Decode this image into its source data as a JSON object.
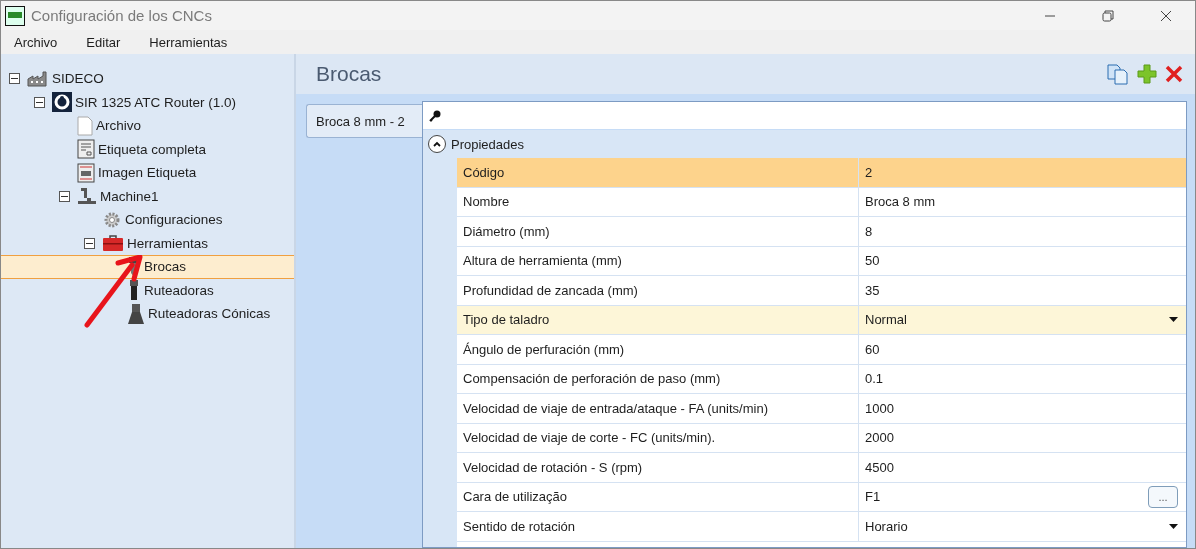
{
  "window": {
    "title": "Configuración de los CNCs"
  },
  "menu": [
    {
      "label": "Archivo"
    },
    {
      "label": "Editar"
    },
    {
      "label": "Herramientas"
    }
  ],
  "tree": [
    {
      "label": "SIDECO",
      "kind": "factory",
      "expanded": true,
      "selected": false,
      "children": [
        {
          "label": "SIR 1325 ATC Router (1.0)",
          "kind": "logo",
          "expanded": true,
          "selected": false,
          "children": [
            {
              "label": "Archivo",
              "kind": "document",
              "selected": false
            },
            {
              "label": "Etiqueta completa",
              "kind": "label",
              "selected": false
            },
            {
              "label": "Imagen Etiqueta",
              "kind": "image-label",
              "selected": false
            },
            {
              "label": "Machine1",
              "kind": "machine",
              "expanded": true,
              "selected": false,
              "children": [
                {
                  "label": "Configuraciones",
                  "kind": "gear",
                  "selected": false
                },
                {
                  "label": "Herramientas",
                  "kind": "toolbox",
                  "expanded": true,
                  "selected": false,
                  "children": [
                    {
                      "label": "Brocas",
                      "kind": "drill",
                      "selected": true
                    },
                    {
                      "label": "Ruteadoras",
                      "kind": "router",
                      "selected": false
                    },
                    {
                      "label": "Ruteadoras Cónicas",
                      "kind": "conical",
                      "selected": false
                    }
                  ]
                }
              ]
            }
          ]
        }
      ]
    }
  ],
  "panel": {
    "title": "Brocas",
    "tabs": [
      {
        "label": "Broca 8 mm - 2",
        "selected": true
      }
    ]
  },
  "property_grid": {
    "category": {
      "label": "Propiedades",
      "expanded": true
    },
    "rows": [
      {
        "name": "Código",
        "value": "2",
        "kind": "text",
        "selected": true,
        "hovered": false
      },
      {
        "name": "Nombre",
        "value": "Broca 8 mm",
        "kind": "text",
        "selected": false,
        "hovered": false
      },
      {
        "name": "Diámetro (mm)",
        "value": "8",
        "kind": "text",
        "selected": false,
        "hovered": false
      },
      {
        "name": "Altura de herramienta (mm)",
        "value": "50",
        "kind": "text",
        "selected": false,
        "hovered": false
      },
      {
        "name": "Profundidad de zancada (mm)",
        "value": "35",
        "kind": "text",
        "selected": false,
        "hovered": false
      },
      {
        "name": "Tipo de taladro",
        "value": "Normal",
        "kind": "dropdown",
        "selected": false,
        "hovered": true
      },
      {
        "name": "Ángulo de perfuración (mm)",
        "value": "60",
        "kind": "text",
        "selected": false,
        "hovered": false
      },
      {
        "name": "Compensación de perforación de paso (mm)",
        "value": "0.1",
        "kind": "text",
        "selected": false,
        "hovered": false
      },
      {
        "name": "Velocidad de viaje de entrada/ataque - FA (units/min)",
        "value": "1000",
        "kind": "text",
        "selected": false,
        "hovered": false
      },
      {
        "name": "Velocidad de viaje de corte - FC (units/min).",
        "value": "2000",
        "kind": "text",
        "selected": false,
        "hovered": false
      },
      {
        "name": "Velocidad de rotación - S (rpm)",
        "value": "4500",
        "kind": "text",
        "selected": false,
        "hovered": false
      },
      {
        "name": "Cara de utilização",
        "value": "F1",
        "kind": "ellipsis",
        "button": "...",
        "selected": false,
        "hovered": false
      },
      {
        "name": "Sentido de rotación",
        "value": "Horario",
        "kind": "dropdown",
        "selected": false,
        "hovered": false
      }
    ]
  }
}
